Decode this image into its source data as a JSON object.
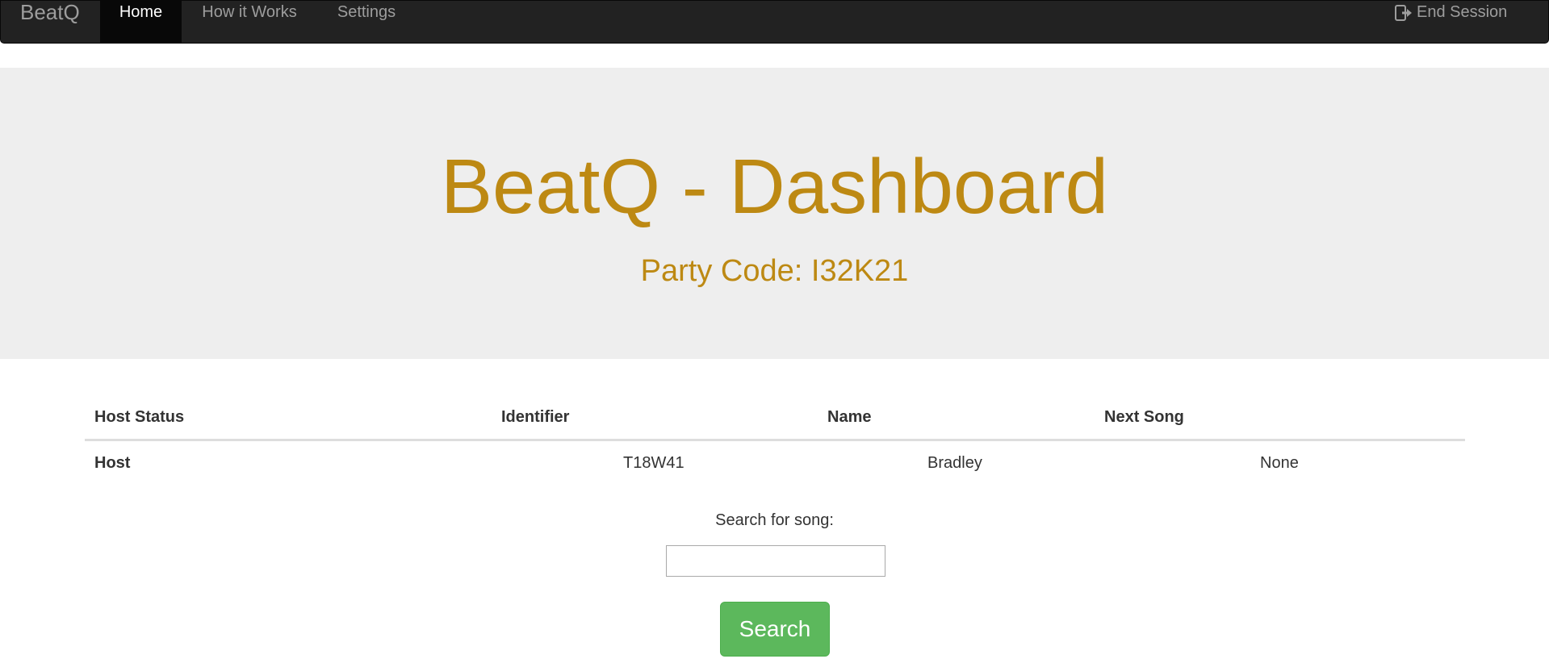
{
  "navbar": {
    "brand": "BeatQ",
    "items": [
      {
        "label": "Home",
        "active": true
      },
      {
        "label": "How it Works",
        "active": false
      },
      {
        "label": "Settings",
        "active": false
      }
    ],
    "end_session": {
      "label": "End Session",
      "icon": "logout-icon"
    }
  },
  "jumbotron": {
    "title": "BeatQ - Dashboard",
    "subtitle": "Party Code: I32K21",
    "accent_color": "#bd8913"
  },
  "table": {
    "headers": [
      "Host Status",
      "Identifier",
      "Name",
      "Next Song"
    ],
    "rows": [
      [
        "Host",
        "T18W41",
        "Bradley",
        "None"
      ]
    ]
  },
  "search": {
    "label": "Search for song:",
    "input_value": "",
    "placeholder": "",
    "button_label": "Search",
    "button_color": "#5cb85c"
  }
}
